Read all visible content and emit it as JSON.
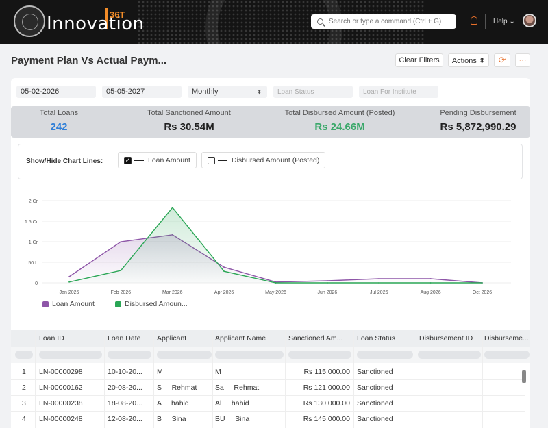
{
  "header": {
    "brand": "Innovation",
    "brand_tag": "36T",
    "search_placeholder": "Search or type a command (Ctrl + G)",
    "help": "Help ⌄"
  },
  "page": {
    "title": "Payment Plan Vs Actual Paym...",
    "clear_filters": "Clear Filters",
    "actions": "Actions ⬍",
    "refresh": "⟳",
    "more": "···"
  },
  "filters": {
    "from_date": "05-02-2026",
    "to_date": "05-05-2027",
    "period": "Monthly",
    "loan_status_ph": "Loan Status",
    "institute_ph": "Loan For Institute"
  },
  "kpis": [
    {
      "label": "Total Loans",
      "value": "242",
      "color": "#2f7fd8"
    },
    {
      "label": "Total Sanctioned Amount",
      "value": "Rs 30.54M",
      "color": "#333333"
    },
    {
      "label": "Total Disbursed Amount (Posted)",
      "value": "Rs 24.66M",
      "color": "#3aa86a"
    },
    {
      "label": "Pending Disbursement",
      "value": "Rs 5,872,990.29",
      "color": "#333333"
    }
  ],
  "chart_lines": {
    "label": "Show/Hide Chart Lines:",
    "opt1": "Loan Amount",
    "opt2": "Disbursed Amount (Posted)"
  },
  "chart_data": {
    "type": "area",
    "categories": [
      "Jan 2026",
      "Feb 2026",
      "Mar 2026",
      "Apr 2026",
      "May 2026",
      "Jun 2026",
      "Jul 2026",
      "Aug 2026",
      "Oct 2026"
    ],
    "y_ticks": [
      "0",
      "50 L",
      "1 Cr",
      "1.5 Cr",
      "2 Cr"
    ],
    "ylim": [
      0,
      2
    ],
    "series": [
      {
        "name": "Loan Amount",
        "color": "#8e56a8",
        "values": [
          0.15,
          1.0,
          1.17,
          0.38,
          0.02,
          0.05,
          0.1,
          0.1,
          0.0
        ]
      },
      {
        "name": "Disbursed Amoun...",
        "color": "#2aa655",
        "values": [
          0.02,
          0.3,
          1.83,
          0.28,
          0.0,
          0.0,
          0.0,
          0.0,
          0.0
        ]
      }
    ]
  },
  "table": {
    "columns": [
      "Loan ID",
      "Loan Date",
      "Applicant",
      "Applicant Name",
      "Sanctioned Am...",
      "Loan Status",
      "Disbursement ID",
      "Disburseme..."
    ],
    "rows": [
      {
        "n": "1",
        "id": "LN-00000298",
        "date": "10-10-20...",
        "applicant": "M",
        "name": "M",
        "amount": "Rs 115,000.00",
        "status": "Sanctioned"
      },
      {
        "n": "2",
        "id": "LN-00000162",
        "date": "20-08-20...",
        "applicant": "S     Rehmat",
        "name": "Sa     Rehmat",
        "amount": "Rs 121,000.00",
        "status": "Sanctioned"
      },
      {
        "n": "3",
        "id": "LN-00000238",
        "date": "18-08-20...",
        "applicant": "A     hahid",
        "name": "Al     hahid",
        "amount": "Rs 130,000.00",
        "status": "Sanctioned"
      },
      {
        "n": "4",
        "id": "LN-00000248",
        "date": "12-08-20...",
        "applicant": "B     Sina",
        "name": "BU     Sina",
        "amount": "Rs 145,000.00",
        "status": "Sanctioned"
      }
    ]
  }
}
